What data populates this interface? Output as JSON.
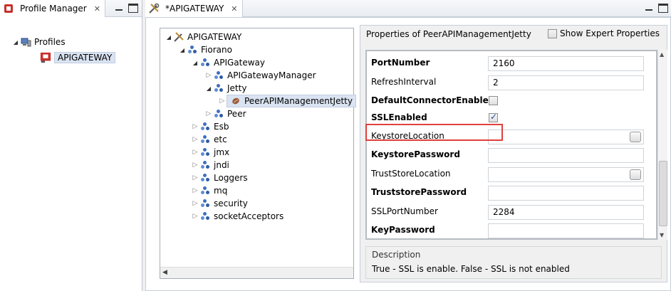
{
  "left_view": {
    "tab_title": "Profile Manager",
    "tree": [
      {
        "label": "Profiles",
        "icon": "computer-icon"
      },
      {
        "label": "APIGATEWAY",
        "icon": "profile-red-icon",
        "selected": true
      }
    ]
  },
  "editor": {
    "tab_title": "*APIGATEWAY",
    "tree": [
      {
        "label": "APIGATEWAY",
        "arrow": "expanded",
        "icon": "tools-icon"
      },
      {
        "label": "Fiorano",
        "arrow": "expanded",
        "icon": "molecule-icon"
      },
      {
        "label": "APIGateway",
        "arrow": "expanded",
        "icon": "molecule-icon"
      },
      {
        "label": "APIGatewayManager",
        "arrow": "collapsed",
        "icon": "molecule-icon"
      },
      {
        "label": "Jetty",
        "arrow": "expanded",
        "icon": "molecule-icon"
      },
      {
        "label": "PeerAPIManagementJetty",
        "arrow": "collapsed",
        "icon": "bean-icon",
        "selected": true
      },
      {
        "label": "Peer",
        "arrow": "collapsed",
        "icon": "molecule-icon"
      },
      {
        "label": "Esb",
        "arrow": "collapsed",
        "icon": "molecule-icon"
      },
      {
        "label": "etc",
        "arrow": "collapsed",
        "icon": "molecule-icon"
      },
      {
        "label": "jmx",
        "arrow": "collapsed",
        "icon": "molecule-icon"
      },
      {
        "label": "jndi",
        "arrow": "collapsed",
        "icon": "molecule-icon"
      },
      {
        "label": "Loggers",
        "arrow": "collapsed",
        "icon": "molecule-icon"
      },
      {
        "label": "mq",
        "arrow": "collapsed",
        "icon": "molecule-icon"
      },
      {
        "label": "security",
        "arrow": "collapsed",
        "icon": "molecule-icon"
      },
      {
        "label": "socketAcceptors",
        "arrow": "collapsed",
        "icon": "molecule-icon"
      }
    ],
    "properties": {
      "header": "Properties of PeerAPIManagementJetty",
      "expert_label": "Show Expert Properties",
      "rows": [
        {
          "name": "PortNumber",
          "bold": true,
          "type": "text",
          "value": "2160"
        },
        {
          "name": "RefreshInterval",
          "bold": false,
          "type": "text",
          "value": "2"
        },
        {
          "name": "DefaultConnectorEnabled",
          "bold": true,
          "type": "checkbox",
          "checked": false
        },
        {
          "name": "SSLEnabled",
          "bold": true,
          "type": "checkbox",
          "checked": true
        },
        {
          "name": "KeystoreLocation",
          "bold": false,
          "type": "browse",
          "value": ""
        },
        {
          "name": "KeystorePassword",
          "bold": true,
          "type": "text",
          "value": ""
        },
        {
          "name": "TrustStoreLocation",
          "bold": false,
          "type": "browse",
          "value": ""
        },
        {
          "name": "TruststorePassword",
          "bold": true,
          "type": "text",
          "value": ""
        },
        {
          "name": "SSLPortNumber",
          "bold": false,
          "type": "text",
          "value": "2284"
        },
        {
          "name": "KeyPassword",
          "bold": true,
          "type": "text",
          "value": ""
        }
      ],
      "description_title": "Description",
      "description_text": "True - SSL is enable. False - SSL is not enabled"
    }
  },
  "colors": {
    "highlight": "#e0403c",
    "selection": "#d9e3f1"
  }
}
